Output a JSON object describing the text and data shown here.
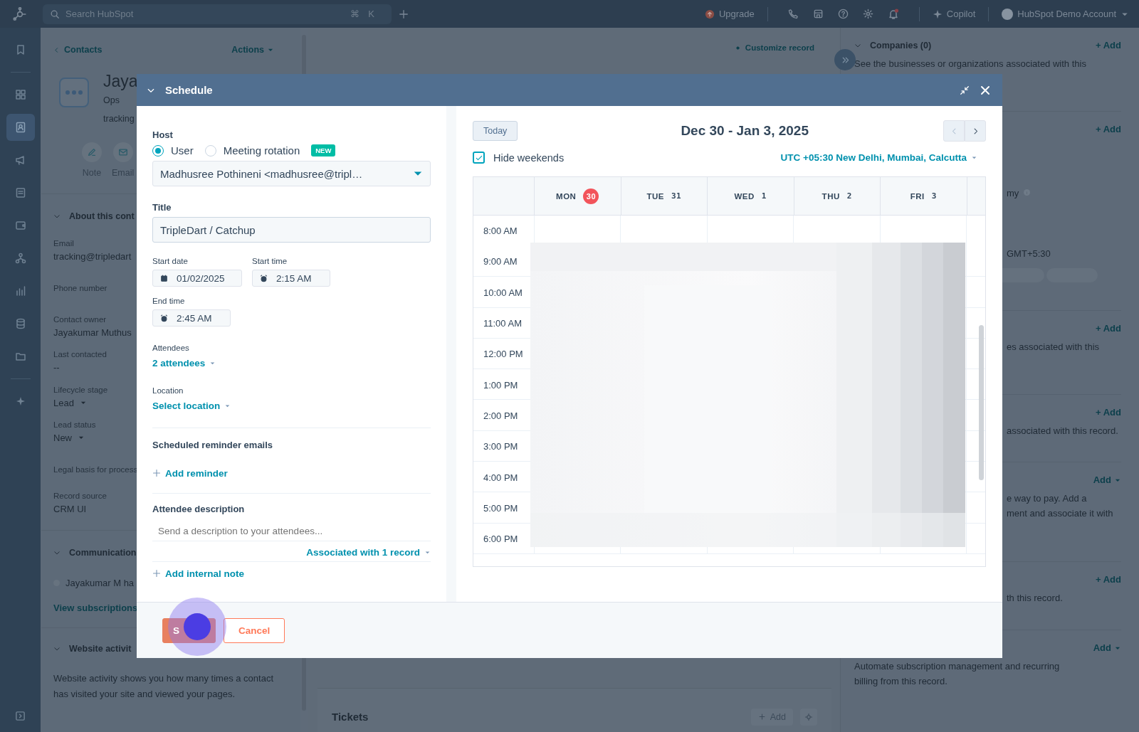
{
  "topbar": {
    "search_placeholder": "Search HubSpot",
    "shortcut": [
      "⌘",
      "K"
    ],
    "upgrade": "Upgrade",
    "copilot": "Copilot",
    "account": "HubSpot Demo Account"
  },
  "nav": {
    "items": [
      {
        "kind": "bookmark",
        "selected": false
      },
      {
        "kind": "grid",
        "selected": false
      },
      {
        "kind": "contacts",
        "selected": true
      },
      {
        "kind": "megaphone",
        "selected": false
      },
      {
        "kind": "document",
        "selected": false
      },
      {
        "kind": "wallet",
        "selected": false
      },
      {
        "kind": "hierarchy",
        "selected": false
      },
      {
        "kind": "chart",
        "selected": false
      },
      {
        "kind": "database",
        "selected": false
      },
      {
        "kind": "folder",
        "selected": false
      },
      {
        "kind": "sparkle",
        "selected": false
      }
    ]
  },
  "record": {
    "back": "Contacts",
    "actions": "Actions",
    "name": "Jaya",
    "subtitle": "Ops",
    "email_short": "tracking",
    "quick_actions": [
      {
        "kind": "note",
        "label": "Note"
      },
      {
        "kind": "email",
        "label": "Email"
      }
    ],
    "about": {
      "heading": "About this cont",
      "fields": [
        {
          "label": "Email",
          "value": "tracking@tripledart",
          "dropdown": false
        },
        {
          "label": "Phone number"
        },
        {
          "label": "Contact owner",
          "value": "Jayakumar Muthus",
          "dropdown": false
        },
        {
          "label": "Last contacted",
          "value": "--",
          "dropdown": false
        },
        {
          "label": "Lifecycle stage",
          "value": "Lead",
          "dropdown": true
        },
        {
          "label": "Lead status",
          "value": "New",
          "dropdown": true
        },
        {
          "label": "Legal basis for process"
        },
        {
          "label": "Record source",
          "value": "CRM UI",
          "dropdown": false
        }
      ]
    },
    "communication": {
      "heading": "Communication",
      "item": "Jayakumar M ha",
      "link": "View subscriptions"
    },
    "website": {
      "heading": "Website activit",
      "text": "Website activity shows you how many times a contact has visited your site and viewed your pages."
    }
  },
  "center": {
    "customize": "Customize record",
    "tickets": {
      "title": "Tickets",
      "add": "Add"
    }
  },
  "right": {
    "sections": [
      {
        "title": "Companies (0)",
        "add": "+ Add",
        "add_menu": false,
        "lines": [
          {
            "text": "See the businesses or organizations associated with this"
          }
        ]
      },
      {
        "kind": "timezone",
        "add": "+ Add",
        "add_menu": false,
        "lines": [
          {
            "text": "my",
            "info": true
          },
          {
            "text": "GMT+5:30"
          }
        ]
      },
      {
        "add": "+ Add",
        "add_menu": false,
        "lines": [
          {
            "text": "es associated with this"
          }
        ]
      },
      {
        "add": "+ Add",
        "add_menu": false,
        "lines": [
          {
            "text": "associated with this record."
          }
        ]
      },
      {
        "add": "Add",
        "add_menu": true,
        "lines": [
          {
            "text": "e way to pay. Add a"
          },
          {
            "text": "ment and associate it with"
          }
        ]
      },
      {
        "add": "+ Add",
        "add_menu": false,
        "lines": [
          {
            "text": "th this record."
          }
        ]
      },
      {
        "add": "Add",
        "add_menu": true,
        "lines": [
          {
            "text": "Automate subscription management and recurring"
          },
          {
            "text": "billing from this record."
          }
        ]
      }
    ]
  },
  "modal": {
    "title": "Schedule",
    "host": {
      "label": "Host",
      "options": [
        {
          "label": "User",
          "selected": true
        },
        {
          "label": "Meeting rotation",
          "selected": false,
          "badge": "NEW"
        }
      ],
      "value": "Madhusree Pothineni <madhusree@tripl…"
    },
    "title_field": {
      "label": "Title",
      "value": "TripleDart / Catchup"
    },
    "start_date": {
      "label": "Start date",
      "value": "01/02/2025"
    },
    "start_time": {
      "label": "Start time",
      "value": "2:15 AM"
    },
    "end_time": {
      "label": "End time",
      "value": "2:45 AM"
    },
    "attendees": {
      "label": "Attendees",
      "value": "2 attendees"
    },
    "location": {
      "label": "Location",
      "value": "Select location"
    },
    "reminders": {
      "heading": "Scheduled reminder emails",
      "add": "Add reminder"
    },
    "description": {
      "heading": "Attendee description",
      "placeholder": "Send a description to your attendees...",
      "association": "Associated with 1 record"
    },
    "internal_note": "Add internal note",
    "buttons": [
      {
        "kind": "primary",
        "label": "S"
      },
      {
        "kind": "secondary",
        "label": "Cancel"
      }
    ],
    "calendar": {
      "today": "Today",
      "range": "Dec 30 - Jan 3, 2025",
      "hide_weekends": {
        "label": "Hide weekends",
        "checked": true
      },
      "timezone": "UTC +05:30 New Delhi, Mumbai, Calcutta",
      "days": [
        {
          "name": "MON",
          "date": "30",
          "selected": true
        },
        {
          "name": "TUE",
          "date": "31",
          "selected": false
        },
        {
          "name": "WED",
          "date": "1",
          "selected": false
        },
        {
          "name": "THU",
          "date": "2",
          "selected": false
        },
        {
          "name": "FRI",
          "date": "3",
          "selected": false
        }
      ],
      "times": [
        "8:00 AM",
        "9:00 AM",
        "10:00 AM",
        "11:00 AM",
        "12:00 PM",
        "1:00 PM",
        "2:00 PM",
        "3:00 PM",
        "4:00 PM",
        "5:00 PM",
        "6:00 PM"
      ]
    }
  }
}
